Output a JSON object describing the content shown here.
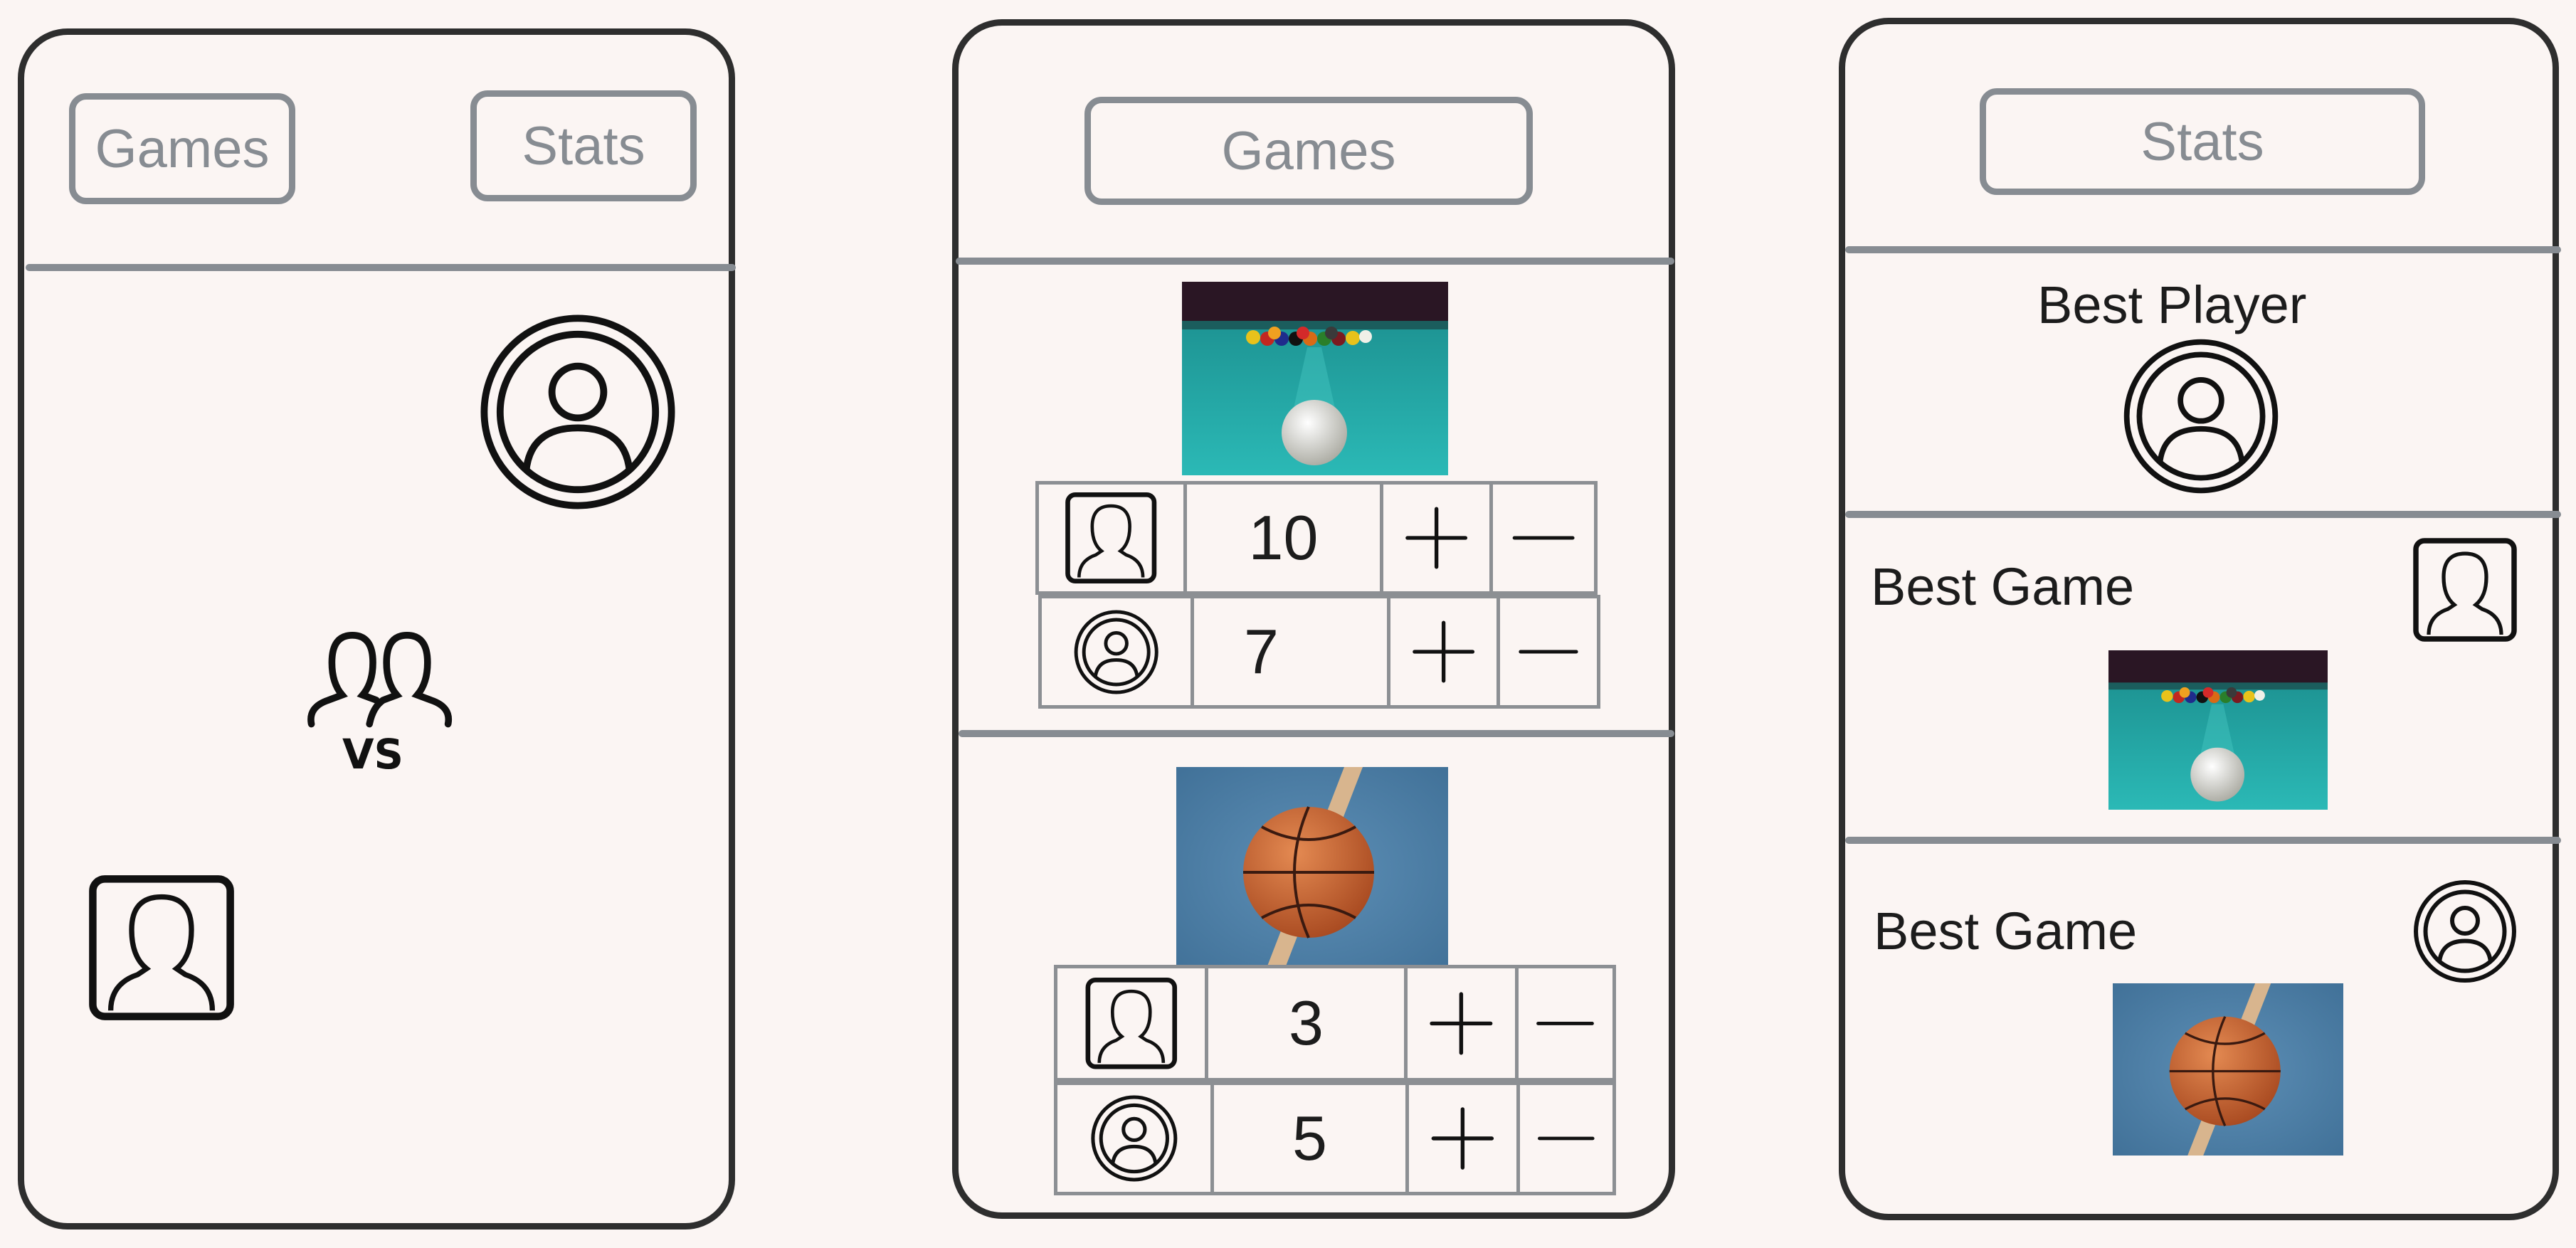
{
  "screen1": {
    "games_tab": "Games",
    "stats_tab": "Stats"
  },
  "screen2": {
    "title": "Games",
    "games": [
      {
        "photo": "billiards-photo",
        "scores": [
          {
            "player_icon": "person-square-icon",
            "score": "10"
          },
          {
            "player_icon": "person-circle-icon",
            "score": "7"
          }
        ]
      },
      {
        "photo": "basketball-photo",
        "scores": [
          {
            "player_icon": "person-square-icon",
            "score": "3"
          },
          {
            "player_icon": "person-circle-icon",
            "score": "5"
          }
        ]
      }
    ]
  },
  "screen3": {
    "title": "Stats",
    "best_player_label": "Best Player",
    "best_game_1_label": "Best Game",
    "best_game_2_label": "Best Game"
  },
  "colors": {
    "background": "#fbf5f3",
    "frame": "#2e2e2e",
    "accent_gray": "#878c92",
    "text": "#1c1c1c"
  }
}
